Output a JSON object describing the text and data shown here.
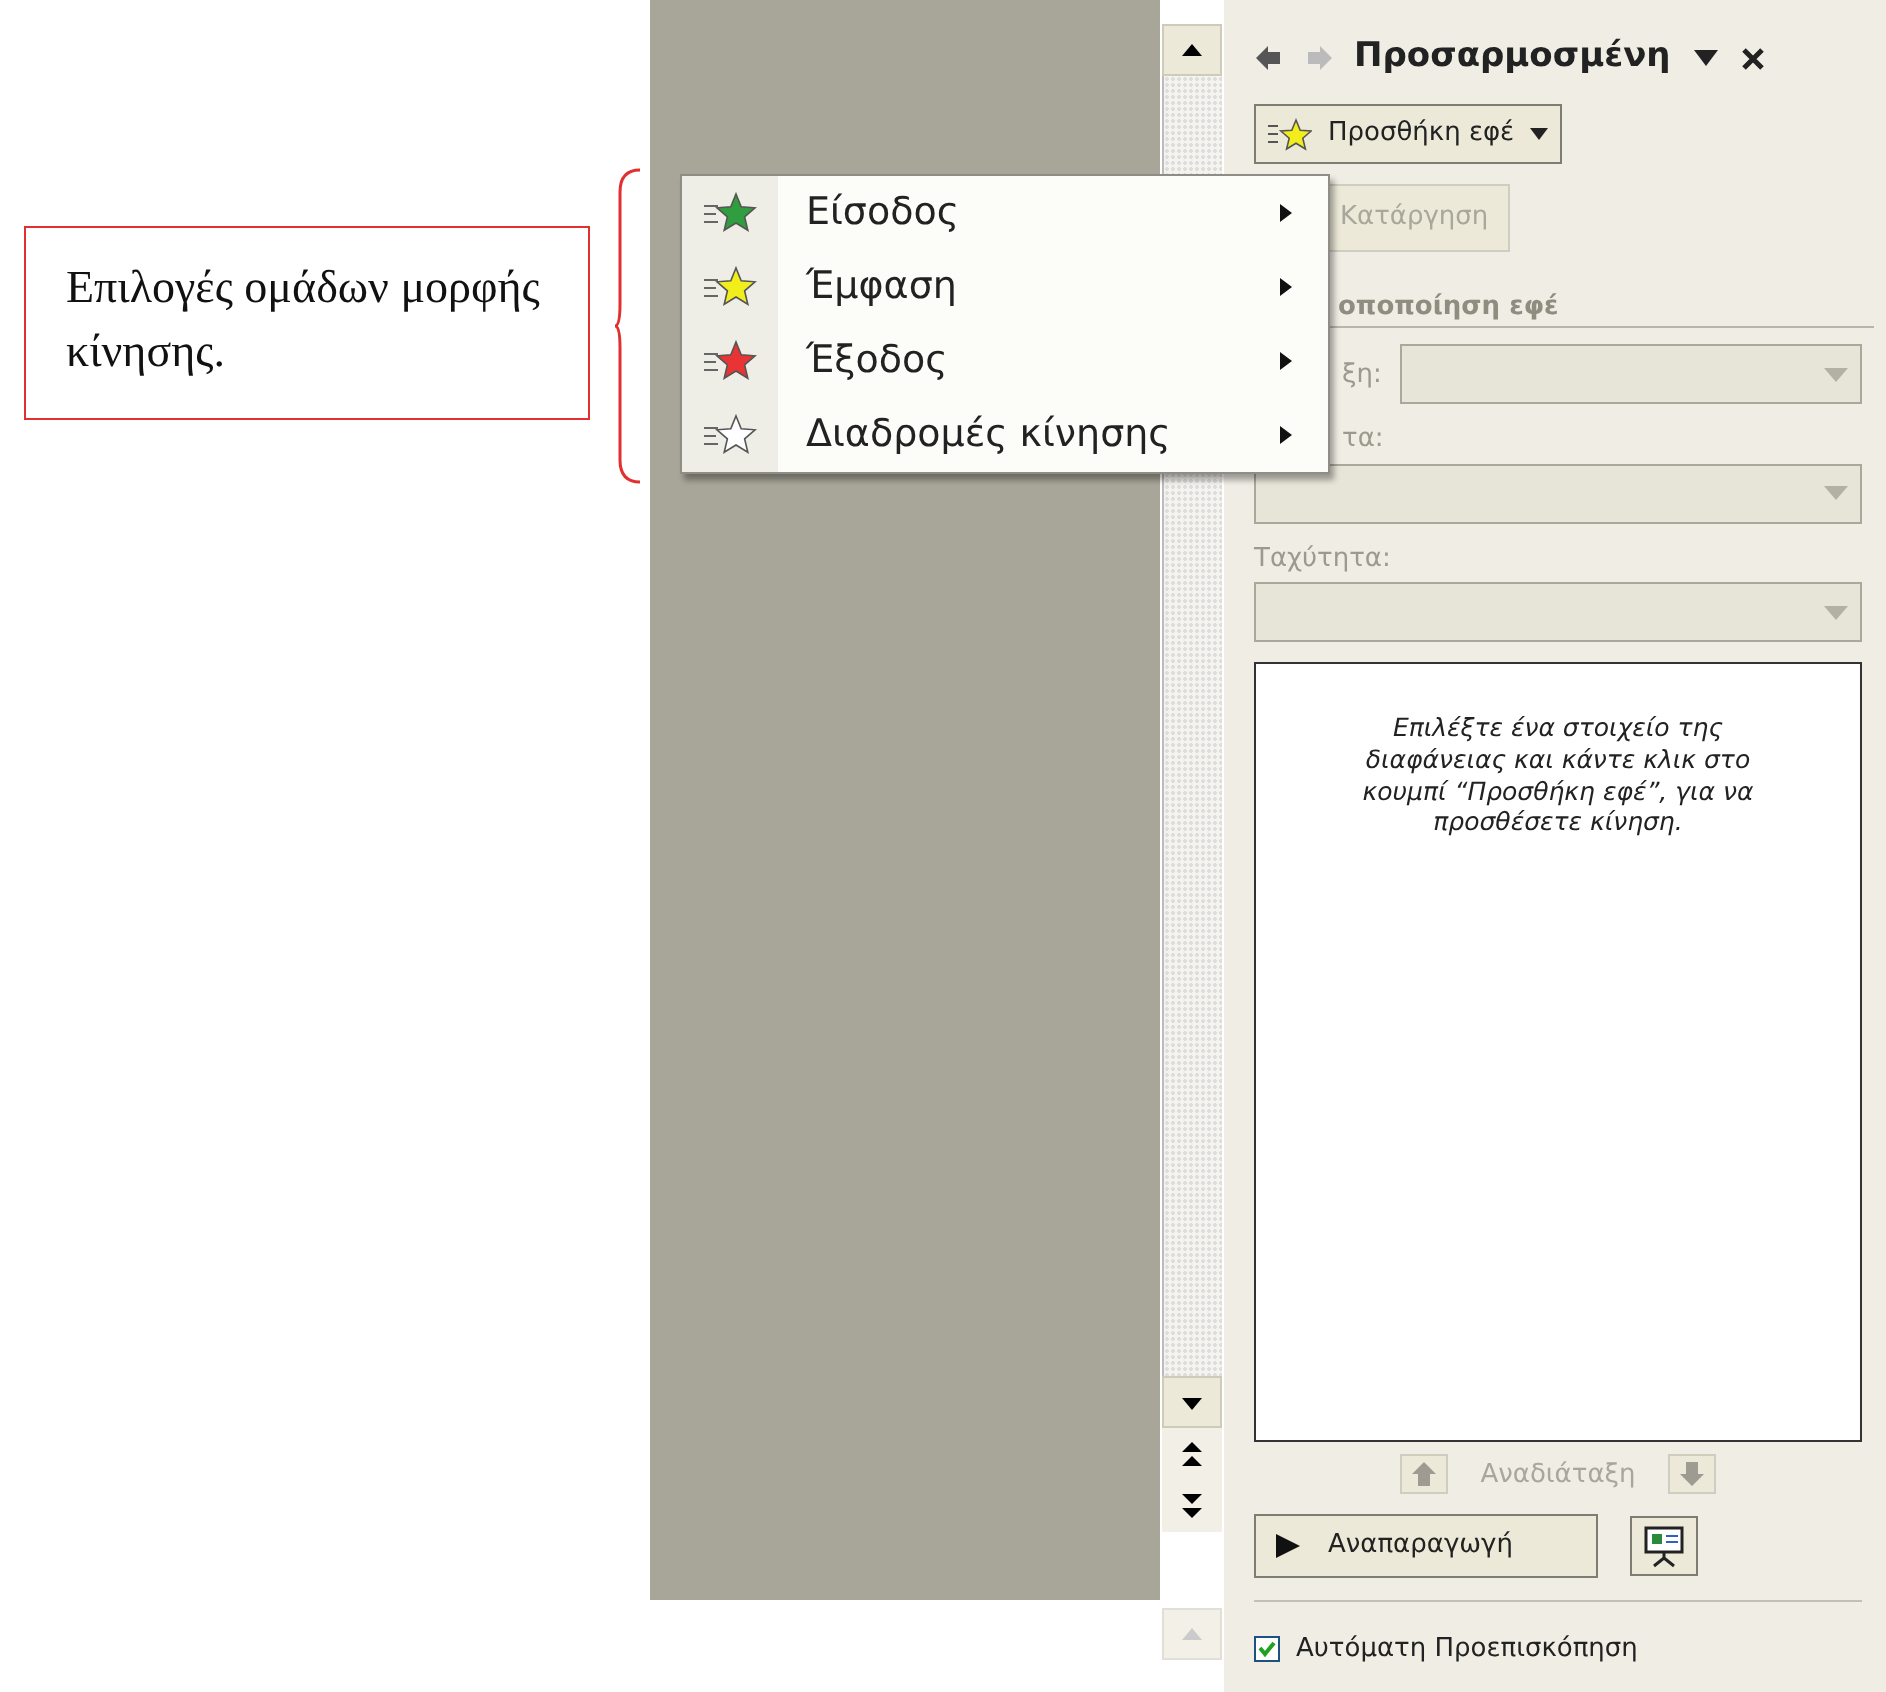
{
  "callout": {
    "text": "Επιλογές ομάδων μορφής κίνησης."
  },
  "menu": {
    "items": [
      {
        "label": "Είσοδος",
        "color": "#2e9e3e"
      },
      {
        "label": "Έμφαση",
        "color": "#f2ee1c"
      },
      {
        "label": "Έξοδος",
        "color": "#e83434"
      },
      {
        "label": "Διαδρομές κίνησης",
        "color": "#ffffff"
      }
    ]
  },
  "task_pane": {
    "title": "Προσαρμοσμένη",
    "add_effect_button": "Προσθήκη εφέ",
    "remove_button": {
      "label": "Κατάργηση",
      "disabled": true
    },
    "section_heading": "οποποίηση εφέ",
    "fields": [
      {
        "label": "ξη:",
        "kind": "inline",
        "disabled": true
      },
      {
        "label": "τα:",
        "kind": "stacked",
        "disabled": true
      },
      {
        "label": "Ταχύτητα:",
        "kind": "stacked",
        "disabled": true
      }
    ],
    "list_hint": "Επιλέξτε ένα στοιχείο της διαφάνειας και κάντε κλικ στο κουμπί “Προσθήκη εφέ”, για να προσθέσετε κίνηση.",
    "reorder": {
      "label": "Αναδιάταξη",
      "disabled": true
    },
    "play_button": "Αναπαραγωγή",
    "auto_preview": {
      "label": "Αυτόματη Προεπισκόπηση",
      "checked": true
    }
  }
}
